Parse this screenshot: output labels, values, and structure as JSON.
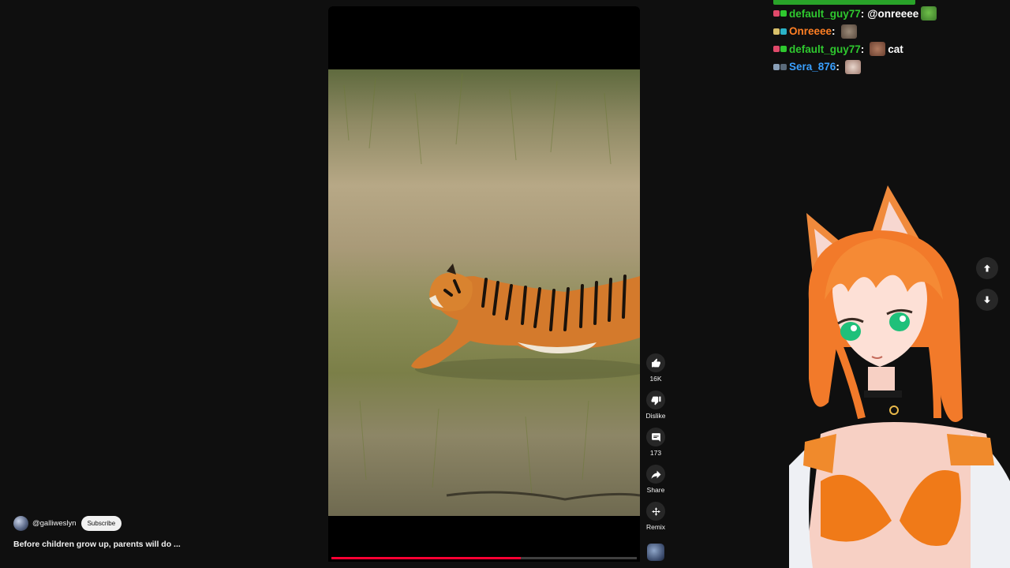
{
  "video": {
    "channel_handle": "@galliweslyn",
    "subscribe_label": "Subscribe",
    "title": "Before children grow up, parents will do ...",
    "progress": 0.62
  },
  "actions": {
    "like_count": "16K",
    "dislike_label": "Dislike",
    "comment_count": "173",
    "share_label": "Share",
    "remix_label": "Remix"
  },
  "chat": {
    "messages": [
      {
        "user": "default_guy77",
        "color": "#2fc82f",
        "text": "@onreeee",
        "emote": "pepe"
      },
      {
        "user": "Onreeee",
        "color": "#ff7f24",
        "text": "",
        "emote": "cat"
      },
      {
        "user": "default_guy77",
        "color": "#2fc82f",
        "text": "cat",
        "emote": "cat-face"
      },
      {
        "user": "Sera_876",
        "color": "#3aa0ff",
        "text": "",
        "emote": "kitten"
      }
    ]
  },
  "icons": [
    "thumbs-up-icon",
    "thumbs-down-icon",
    "comment-icon",
    "share-icon",
    "remix-icon",
    "arrow-up-icon",
    "arrow-down-icon"
  ]
}
